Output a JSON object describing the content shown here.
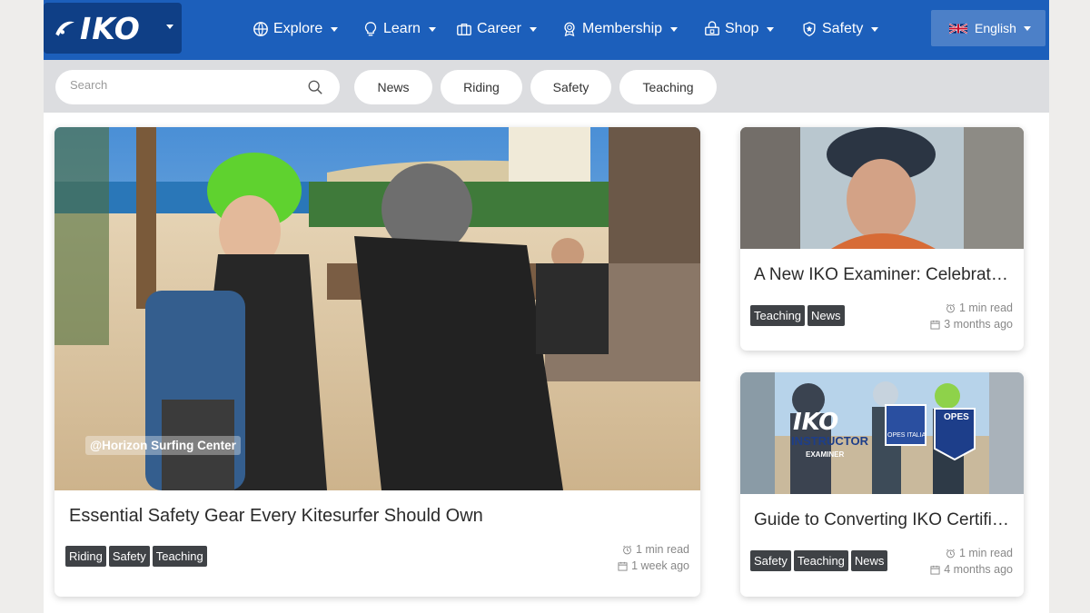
{
  "header": {
    "logo_text": "IKO",
    "nav": [
      {
        "label": "Explore",
        "icon": "globe-icon"
      },
      {
        "label": "Learn",
        "icon": "lightbulb-icon"
      },
      {
        "label": "Career",
        "icon": "briefcase-icon"
      },
      {
        "label": "Membership",
        "icon": "badge-icon"
      },
      {
        "label": "Shop",
        "icon": "shop-icon"
      },
      {
        "label": "Safety",
        "icon": "shield-icon"
      }
    ],
    "language": "English"
  },
  "filters": {
    "search_placeholder": "Search",
    "chips": [
      "News",
      "Riding",
      "Safety",
      "Teaching"
    ]
  },
  "articles": [
    {
      "title": "Essential Safety Gear Every Kitesurfer Should Own",
      "tags": [
        "Riding",
        "Safety",
        "Teaching"
      ],
      "read_time": "1 min read",
      "date": "1 week ago",
      "credit": "@Horizon Surfing Center"
    },
    {
      "title": "A New IKO Examiner: Celebrating",
      "tags": [
        "Teaching",
        "News"
      ],
      "read_time": "1 min read",
      "date": "3 months ago"
    },
    {
      "title": "Guide to Converting IKO Certifications",
      "tags": [
        "Safety",
        "Teaching",
        "News"
      ],
      "read_time": "1 min read",
      "date": "4 months ago",
      "image_text": {
        "brand": "IKO",
        "line1": "INSTRUCTOR",
        "line2": "EXAMINER",
        "badge1": "OPES ITALIA",
        "badge2": "OPES"
      }
    }
  ],
  "colors": {
    "nav_bg": "#1c5fbb",
    "logo_bg": "#0f3f86",
    "filter_bg": "#dcdde0",
    "tag_bg": "#3f4246"
  }
}
